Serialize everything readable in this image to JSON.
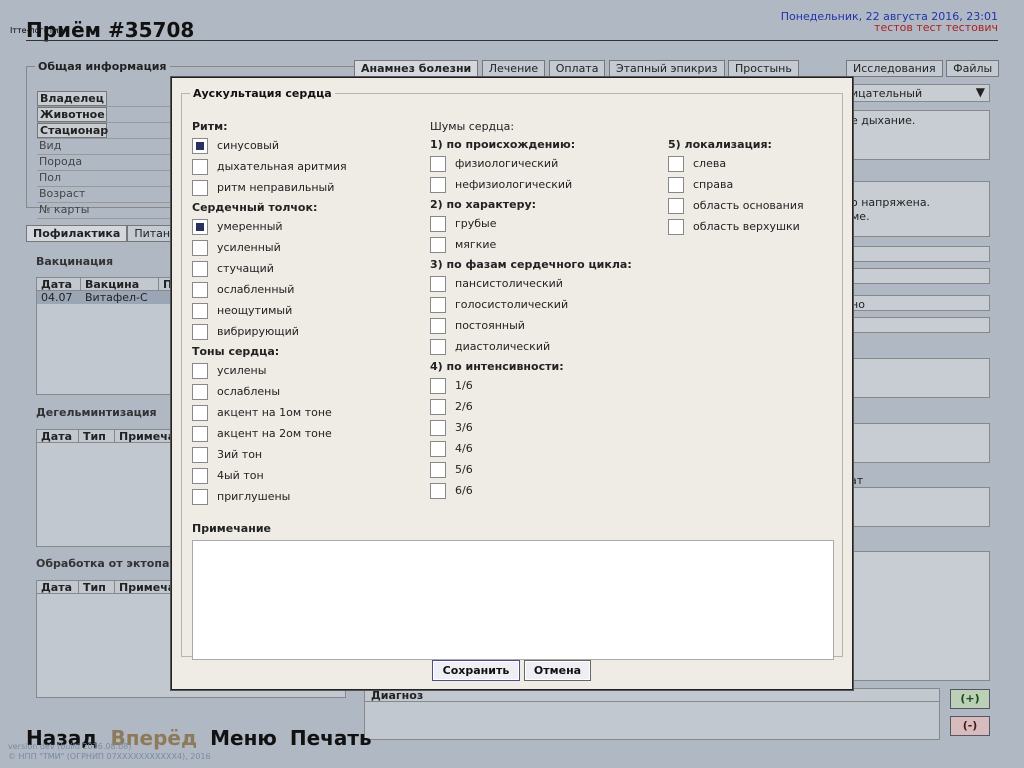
{
  "background": {
    "small_label": "Ітте-логотип",
    "title": "Приём #35708",
    "date": "Понедельник, 22 августа 2016, 23:01",
    "user": "тестов тест тестович",
    "general_info": {
      "legend": "Общая информация",
      "rows": [
        "Владелец",
        "Животное",
        "Стационар",
        "Вид",
        "Порода",
        "Пол",
        "Возраст",
        "№ карты"
      ]
    },
    "left_tabs": [
      "Пофилактика",
      "Питан"
    ],
    "vaccination": {
      "label": "Вакцинация",
      "headers": [
        "Дата",
        "Вакцина",
        "П"
      ],
      "row": [
        "04.07",
        "Витафел-С"
      ]
    },
    "deworming": {
      "label": "Дегельминтизация",
      "headers": [
        "Дата",
        "Тип",
        "Примеча"
      ]
    },
    "ecto": {
      "label": "Обработка от эктопа",
      "headers": [
        "Дата",
        "Тип",
        "Примеча"
      ]
    },
    "right_tabs": [
      "Анамнез болезни",
      "Лечение",
      "Оплата",
      "Этапный эпикриз",
      "Простынь"
    ],
    "right_tabs2": [
      "Исследования",
      "Файлы"
    ],
    "right_texts": [
      "ицательный",
      "е дыхание.",
      "о напряжена.",
      "ме.",
      "но",
      "ат"
    ],
    "nav": [
      "Назад",
      "Вперёд",
      "Меню",
      "Печать"
    ],
    "copyright1": "version dev (build 2016.08.08)",
    "copyright2": "© НПП \"ТМИ\" (ОГРНИП 07XXXXXXXXXXX4), 2016",
    "diagnosis_label": "Диагноз",
    "plus_btn": "(+)",
    "minus_btn": "(-)"
  },
  "modal": {
    "title": "Аускультация сердца",
    "rhythm": {
      "heading": "Ритм:",
      "items": [
        {
          "label": "синусовый",
          "checked": true
        },
        {
          "label": "дыхательная аритмия",
          "checked": false
        },
        {
          "label": "ритм неправильный",
          "checked": false
        }
      ]
    },
    "apex_beat": {
      "heading": "Сердечный толчок:",
      "items": [
        {
          "label": "умеренный",
          "checked": true
        },
        {
          "label": "усиленный",
          "checked": false
        },
        {
          "label": "стучащий",
          "checked": false
        },
        {
          "label": "ослабленный",
          "checked": false
        },
        {
          "label": "неощутимый",
          "checked": false
        },
        {
          "label": "вибрирующий",
          "checked": false
        }
      ]
    },
    "tones": {
      "heading": "Тоны сердца:",
      "items": [
        {
          "label": "усилены",
          "checked": false
        },
        {
          "label": "ослаблены",
          "checked": false
        },
        {
          "label": "акцент на 1ом тоне",
          "checked": false
        },
        {
          "label": "акцент на 2ом тоне",
          "checked": false
        },
        {
          "label": "3ий тон",
          "checked": false
        },
        {
          "label": "4ый тон",
          "checked": false
        },
        {
          "label": "приглушены",
          "checked": false
        }
      ]
    },
    "murmurs_heading": "Шумы сердца:",
    "origin": {
      "heading": "1) по происхождению:",
      "items": [
        {
          "label": "физиологический",
          "checked": false
        },
        {
          "label": "нефизиологический",
          "checked": false
        }
      ]
    },
    "character": {
      "heading": "2) по характеру:",
      "items": [
        {
          "label": "грубые",
          "checked": false
        },
        {
          "label": "мягкие",
          "checked": false
        }
      ]
    },
    "phases": {
      "heading": "3) по фазам сердечного цикла:",
      "items": [
        {
          "label": "пансистолический",
          "checked": false
        },
        {
          "label": "голосистолический",
          "checked": false
        },
        {
          "label": "постоянный",
          "checked": false
        },
        {
          "label": "диастолический",
          "checked": false
        }
      ]
    },
    "intensity": {
      "heading": "4) по интенсивности:",
      "items": [
        {
          "label": "1/6",
          "checked": false
        },
        {
          "label": "2/6",
          "checked": false
        },
        {
          "label": "3/6",
          "checked": false
        },
        {
          "label": "4/6",
          "checked": false
        },
        {
          "label": "5/6",
          "checked": false
        },
        {
          "label": "6/6",
          "checked": false
        }
      ]
    },
    "localization": {
      "heading": "5) локализация:",
      "items": [
        {
          "label": "слева",
          "checked": false
        },
        {
          "label": "справа",
          "checked": false
        },
        {
          "label": "область основания",
          "checked": false
        },
        {
          "label": "область верхушки",
          "checked": false
        }
      ]
    },
    "note_label": "Примечание",
    "note_value": "",
    "save_label": "Сохранить",
    "cancel_label": "Отмена"
  }
}
